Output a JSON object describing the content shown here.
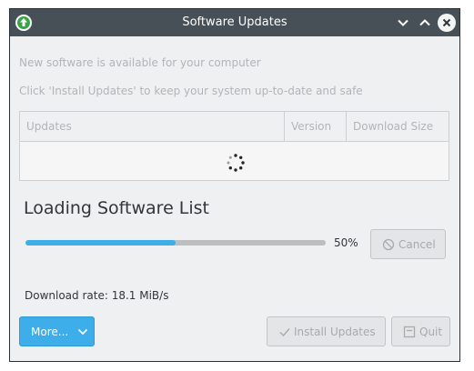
{
  "window": {
    "title": "Software Updates",
    "icons": {
      "app": "software-update-icon",
      "minimize": "chevron-down-icon",
      "maximize": "chevron-up-icon",
      "close": "close-icon"
    }
  },
  "main": {
    "headline": "New software is available for your computer",
    "subline": "Click 'Install Updates' to keep your system up-to-date and safe"
  },
  "updates_table": {
    "columns": [
      "Updates",
      "Version",
      "Download Size"
    ],
    "rows": [],
    "loading_icon": "spinner-icon"
  },
  "progress": {
    "title": "Loading Software List",
    "percent": 50,
    "percent_label": "50%",
    "cancel_label": "Cancel",
    "cancel_icon": "cancel-icon"
  },
  "status": {
    "download_rate": "Download rate: 18.1 MiB/s"
  },
  "buttons": {
    "more_label": "More...",
    "more_icon": "chevron-down-icon",
    "install_label": "Install Updates",
    "install_icon": "checkmark-icon",
    "quit_label": "Quit",
    "quit_icon": "quit-icon"
  },
  "colors": {
    "titlebar": "#475057",
    "accent": "#3daee9",
    "app_icon": "#3aa547",
    "disabled_text": "#a7abae"
  }
}
